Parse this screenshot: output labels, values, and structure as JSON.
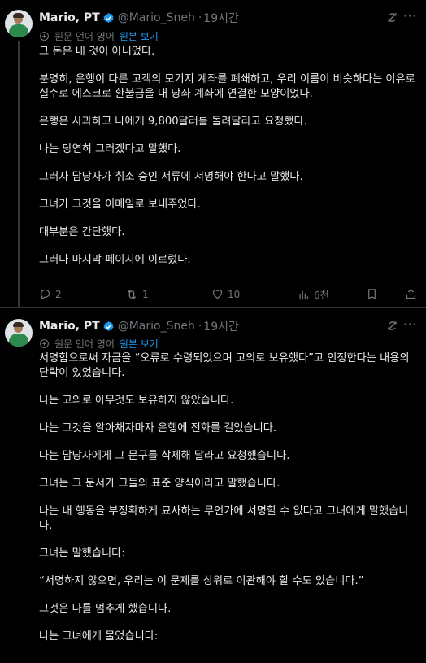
{
  "tweets": [
    {
      "author": {
        "name": "Mario, PT",
        "handle": "@Mario_Sneh",
        "time": "19시간"
      },
      "translation": {
        "label": "원문 언어 영어",
        "link": "원본 보기"
      },
      "paragraphs": [
        "그 돈은 내 것이 아니었다.",
        "분명히, 은행이 다른 고객의 모기지 계좌를 폐쇄하고, 우리 이름이 비슷하다는 이유로 실수로 에스크로 환불금을 내 당좌 계좌에 연결한 모양이었다.",
        "은행은 사과하고 나에게 9,800달러를 돌려달라고 요청했다.",
        "나는 당연히 그러겠다고 말했다.",
        "그러자 담당자가 취소 승인 서류에 서명해야 한다고 말했다.",
        "그녀가 그것을 이메일로 보내주었다.",
        "대부분은 간단했다.",
        "그러다 마지막 페이지에 이르렀다."
      ],
      "actions": {
        "replies": "2",
        "reposts": "1",
        "likes": "10",
        "views": "6천"
      }
    },
    {
      "author": {
        "name": "Mario, PT",
        "handle": "@Mario_Sneh",
        "time": "19시간"
      },
      "translation": {
        "label": "원문 언어 영어",
        "link": "원본 보기"
      },
      "paragraphs": [
        "서명함으로써 자금을 “오류로 수령되었으며 고의로 보유했다”고 인정한다는 내용의 단락이 있었습니다.",
        "나는 고의로 아무것도 보유하지 않았습니다.",
        "나는 그것을 알아채자마자 은행에 전화를 걸었습니다.",
        "나는 담당자에게 그 문구를 삭제해 달라고 요청했습니다.",
        "그녀는 그 문서가 그들의 표준 양식이라고 말했습니다.",
        "나는 내 행동을 부정확하게 묘사하는 무언가에 서명할 수 없다고 그녀에게 말했습니다.",
        "그녀는 말했습니다:",
        "“서명하지 않으면, 우리는 이 문제를 상위로 이관해야 할 수도 있습니다.”",
        "그것은 나를 멈추게 했습니다.",
        "나는 그녀에게 물었습니다:"
      ]
    }
  ]
}
